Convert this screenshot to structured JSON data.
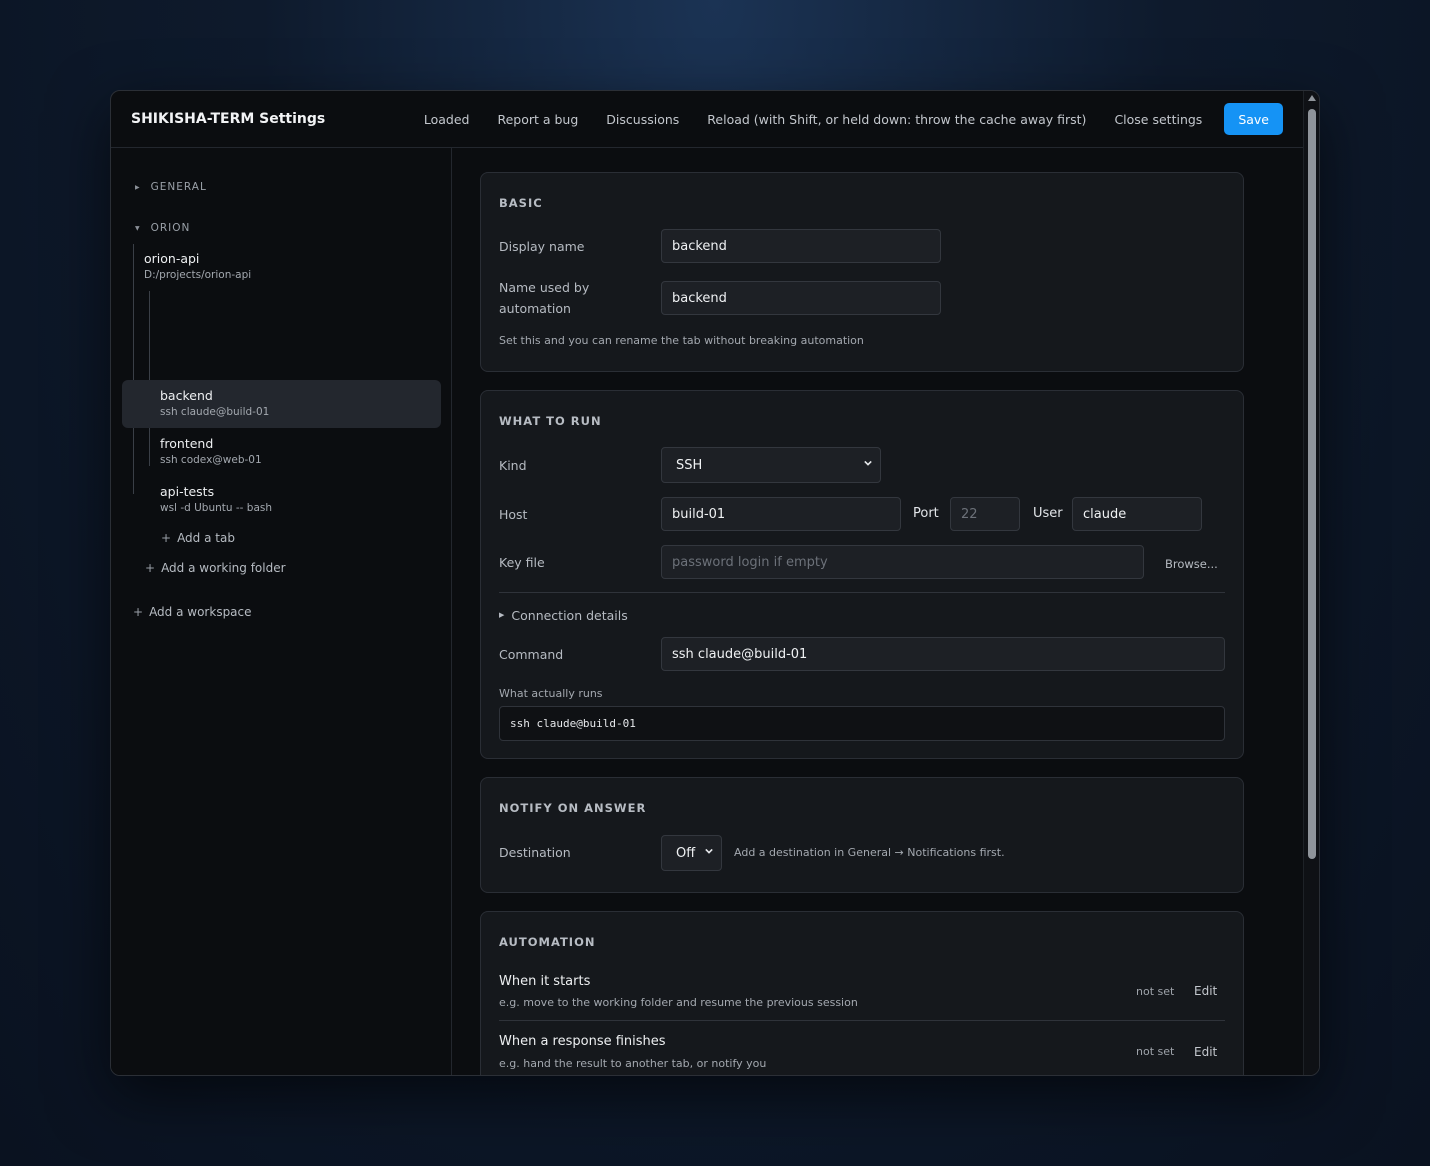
{
  "header": {
    "title": "SHIKISHA-TERM Settings",
    "links": [
      "Loaded",
      "Report a bug",
      "Discussions",
      "Reload (with Shift, or held down: throw the cache away first)",
      "Close settings"
    ],
    "save_label": "Save"
  },
  "sidebar": {
    "general_label": "GENERAL",
    "orion_label": "ORION",
    "folder": {
      "name": "orion-api",
      "path": "D:/projects/orion-api"
    },
    "tabs": [
      {
        "name": "backend",
        "cmd": "ssh claude@build-01",
        "active": true
      },
      {
        "name": "frontend",
        "cmd": "ssh codex@web-01",
        "active": false
      },
      {
        "name": "api-tests",
        "cmd": "wsl -d Ubuntu -- bash",
        "active": false
      }
    ],
    "add_tab": "Add a tab",
    "add_folder": "Add a working folder",
    "add_workspace": "Add a workspace"
  },
  "basic": {
    "title": "BASIC",
    "display_name_label": "Display name",
    "display_name_value": "backend",
    "automation_name_label": "Name used by automation",
    "automation_name_value": "backend",
    "hint": "Set this and you can rename the tab without breaking automation"
  },
  "run": {
    "title": "WHAT TO RUN",
    "kind_label": "Kind",
    "kind_value": "SSH",
    "host_label": "Host",
    "host_value": "build-01",
    "port_label": "Port",
    "port_placeholder": "22",
    "user_label": "User",
    "user_value": "claude",
    "keyfile_label": "Key file",
    "keyfile_placeholder": "password login if empty",
    "browse_label": "Browse...",
    "connection_details": "Connection details",
    "command_label": "Command",
    "command_value": "ssh claude@build-01",
    "actual_label": "What actually runs",
    "actual_value": "ssh claude@build-01"
  },
  "notify": {
    "title": "NOTIFY ON ANSWER",
    "destination_label": "Destination",
    "destination_value": "Off",
    "hint": "Add a destination in General → Notifications first."
  },
  "automation": {
    "title": "AUTOMATION",
    "items": [
      {
        "title": "When it starts",
        "sub": "e.g. move to the working folder and resume the previous session",
        "status": "not set",
        "edit": "Edit"
      },
      {
        "title": "When a response finishes",
        "sub": "e.g. hand the result to another tab, or notify you",
        "status": "not set",
        "edit": "Edit"
      }
    ]
  }
}
